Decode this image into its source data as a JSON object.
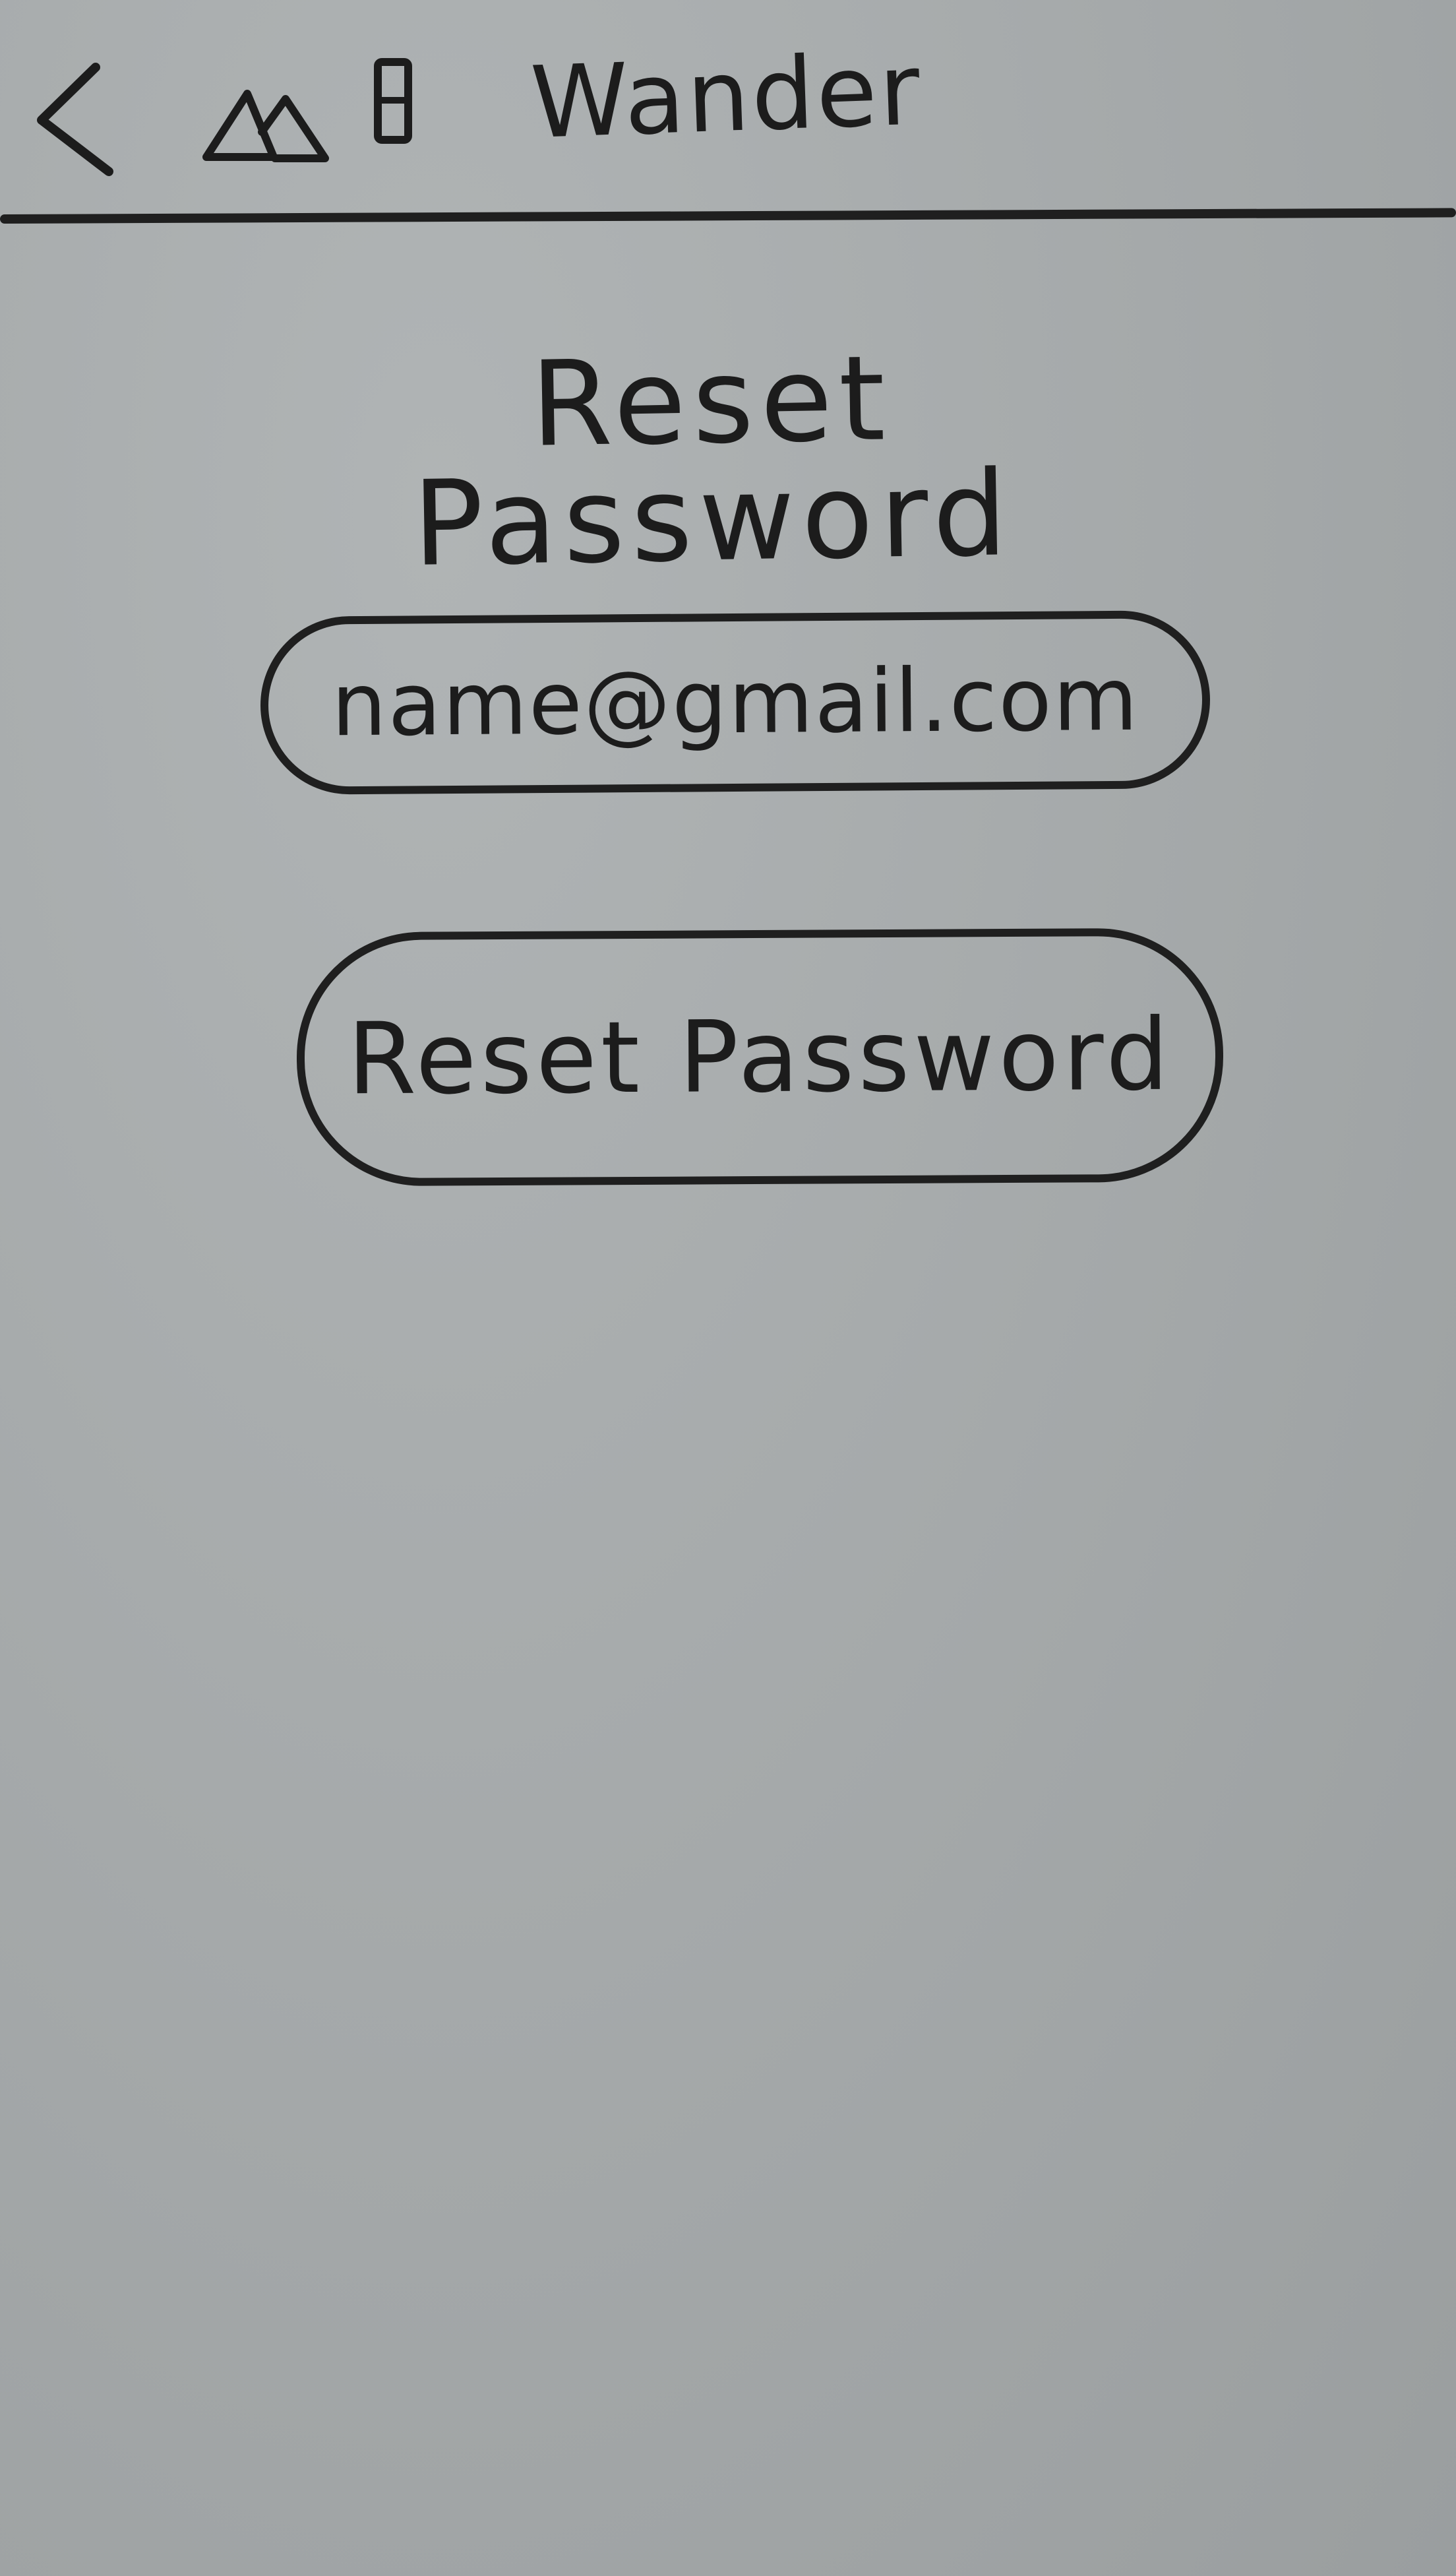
{
  "header": {
    "app_title": "Wander",
    "back_icon": "back-chevron-icon",
    "logo_icon": "mountain-logo-icon"
  },
  "main": {
    "page_title": "Reset Password",
    "email_field": {
      "value": "name@gmail.com"
    },
    "reset_button_label": "Reset Password"
  }
}
